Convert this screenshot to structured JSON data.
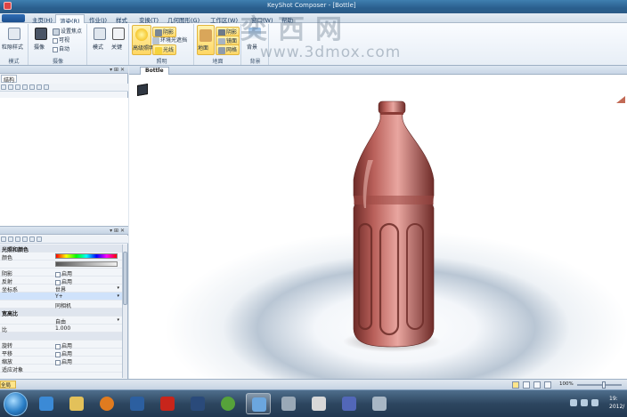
{
  "window": {
    "title": "KeyShot Composer - [Bottle]"
  },
  "watermark": {
    "cn": "奕西网",
    "url": "www.3dmox.com"
  },
  "tabs": [
    {
      "label": "主页(H)",
      "active": false
    },
    {
      "label": "渲染(R)",
      "active": true
    },
    {
      "label": "作业(J)",
      "active": false
    },
    {
      "label": "样式",
      "active": false
    },
    {
      "label": "变换(T)",
      "active": false
    },
    {
      "label": "几何图形(G)",
      "active": false
    },
    {
      "label": "工作区(W)",
      "active": false
    },
    {
      "label": "窗口(W)",
      "active": false
    },
    {
      "label": "帮助",
      "active": false
    }
  ],
  "ribbon": {
    "groups": [
      {
        "label": "模式",
        "buttons": [
          "粒隙样式"
        ]
      },
      {
        "label": "摄像",
        "buttons": [
          "摄像",
          "设置焦点",
          "可视",
          "自动"
        ]
      },
      {
        "label": "",
        "buttons": [
          "模式",
          "关键"
        ]
      },
      {
        "label": "照明",
        "buttons": [
          "高级照明",
          "阴影",
          "环境光遮挡",
          "光线"
        ]
      },
      {
        "label": "地面",
        "buttons": [
          "地面",
          "阴影",
          "镜面",
          "网格"
        ]
      },
      {
        "label": "背景",
        "buttons": [
          "背景"
        ]
      }
    ]
  },
  "left_panel": {
    "tree_header": "",
    "tree_tab": "结构",
    "props_header": "",
    "properties": [
      {
        "key": "光照和颜色",
        "value": "",
        "type": "section"
      },
      {
        "key": "颜色",
        "value": "",
        "type": "gradient"
      },
      {
        "key": "",
        "value": "",
        "type": "gray"
      },
      {
        "key": "阴影",
        "value": "启用",
        "type": "check"
      },
      {
        "key": "反射",
        "value": "启用",
        "type": "check"
      },
      {
        "key": "坐标系",
        "value": "世界",
        "type": "dropdown"
      },
      {
        "key": "",
        "value": "Y+",
        "type": "dropdown",
        "selected": true
      },
      {
        "key": "",
        "value": "同相机",
        "type": "text"
      },
      {
        "key": "宽高比",
        "value": "",
        "type": "section"
      },
      {
        "key": "",
        "value": "自由",
        "type": "dropdown"
      },
      {
        "key": "比",
        "value": "1.000",
        "type": "text"
      },
      {
        "key": "",
        "value": "",
        "type": "section"
      },
      {
        "key": "旋转",
        "value": "启用",
        "type": "check"
      },
      {
        "key": "平移",
        "value": "启用",
        "type": "check"
      },
      {
        "key": "缩放",
        "value": "启用",
        "type": "check"
      },
      {
        "key": "适应对象",
        "value": "",
        "type": "text"
      }
    ]
  },
  "document": {
    "tab": "Bottle"
  },
  "status": {
    "left": "全局",
    "zoom": "100%"
  },
  "clock": {
    "time": "19:",
    "date": "2012/"
  },
  "colors": {
    "bottle": "#b9605a",
    "bottle_dark": "#6e2b28",
    "bottle_light": "#e9a6a0",
    "accent": "#ffd764"
  }
}
